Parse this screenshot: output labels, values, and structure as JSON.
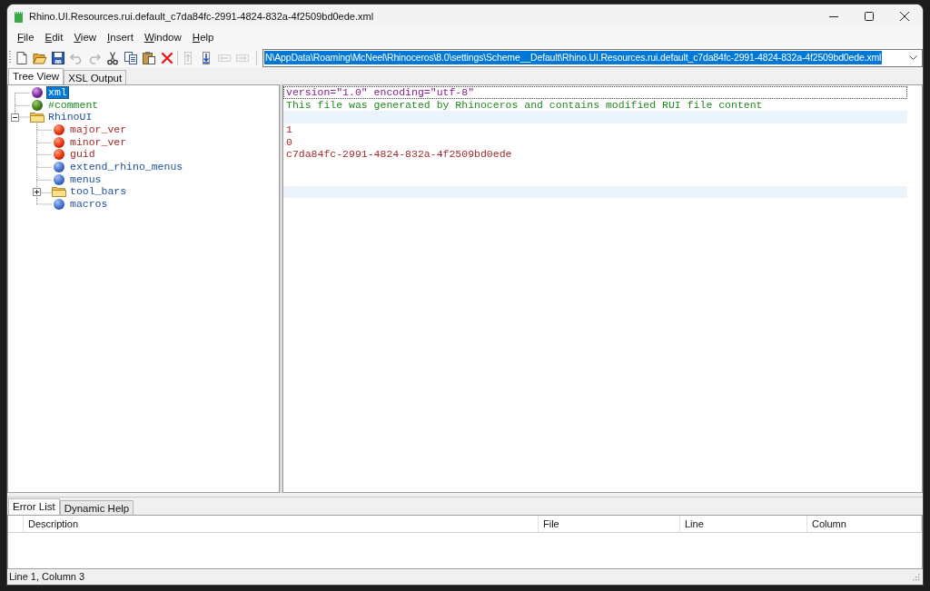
{
  "window": {
    "title": "Rhino.UI.Resources.rui.default_c7da84fc-2991-4824-832a-4f2509bd0ede.xml"
  },
  "menu": [
    "File",
    "Edit",
    "View",
    "Insert",
    "Window",
    "Help"
  ],
  "toolbar": {
    "groups": [
      {
        "buttons": [
          {
            "kind": "new",
            "disabled": false
          },
          {
            "kind": "open",
            "disabled": false
          },
          {
            "kind": "save",
            "disabled": false
          },
          {
            "kind": "undo",
            "disabled": true
          },
          {
            "kind": "redo",
            "disabled": true
          },
          {
            "kind": "cut",
            "disabled": false
          },
          {
            "kind": "copy",
            "disabled": false
          },
          {
            "kind": "paste",
            "disabled": false
          },
          {
            "kind": "delete",
            "disabled": false
          }
        ]
      },
      {
        "buttons": [
          {
            "kind": "move_up",
            "disabled": true
          },
          {
            "kind": "move_down",
            "disabled": false
          },
          {
            "kind": "outdent",
            "disabled": true
          },
          {
            "kind": "indent",
            "disabled": true
          }
        ]
      }
    ]
  },
  "address": {
    "value": "N\\AppData\\Roaming\\McNeel\\Rhinoceros\\8.0\\settings\\Scheme__Default\\Rhino.UI.Resources.rui.default_c7da84fc-2991-4824-832a-4f2509bd0ede.xml",
    "text_selected": true
  },
  "view_tabs": [
    {
      "label": "Tree View",
      "selected": true
    },
    {
      "label": "XSL Output",
      "selected": false
    }
  ],
  "tree": [
    {
      "label": "xml",
      "kind": "declaration",
      "selected": true,
      "value": "version=\"1.0\" encoding=\"utf-8\""
    },
    {
      "label": "#comment",
      "kind": "comment",
      "selected": false,
      "value": "This file was generated by Rhinoceros and contains modified RUI file content"
    },
    {
      "label": "RhinoUI",
      "kind": "element",
      "selected": false,
      "expanded": true,
      "children": [
        {
          "label": "major_ver",
          "kind": "value",
          "selected": false,
          "value": "1"
        },
        {
          "label": "minor_ver",
          "kind": "value",
          "selected": false,
          "value": "0"
        },
        {
          "label": "guid",
          "kind": "value",
          "selected": false,
          "value": "c7da84fc-2991-4824-832a-4f2509bd0ede"
        },
        {
          "label": "extend_rhino_menus",
          "kind": "empty",
          "selected": false
        },
        {
          "label": "menus",
          "kind": "empty",
          "selected": false
        },
        {
          "label": "tool_bars",
          "kind": "element",
          "selected": false,
          "expanded": false
        },
        {
          "label": "macros",
          "kind": "empty",
          "selected": false
        }
      ]
    }
  ],
  "bottom_tabs": [
    {
      "label": "Error List",
      "selected": true
    },
    {
      "label": "Dynamic Help",
      "selected": false
    }
  ],
  "error_list": {
    "columns": [
      "Description",
      "File",
      "Line",
      "Column"
    ]
  },
  "status_bar": {
    "text": "Line 1, Column 3"
  }
}
